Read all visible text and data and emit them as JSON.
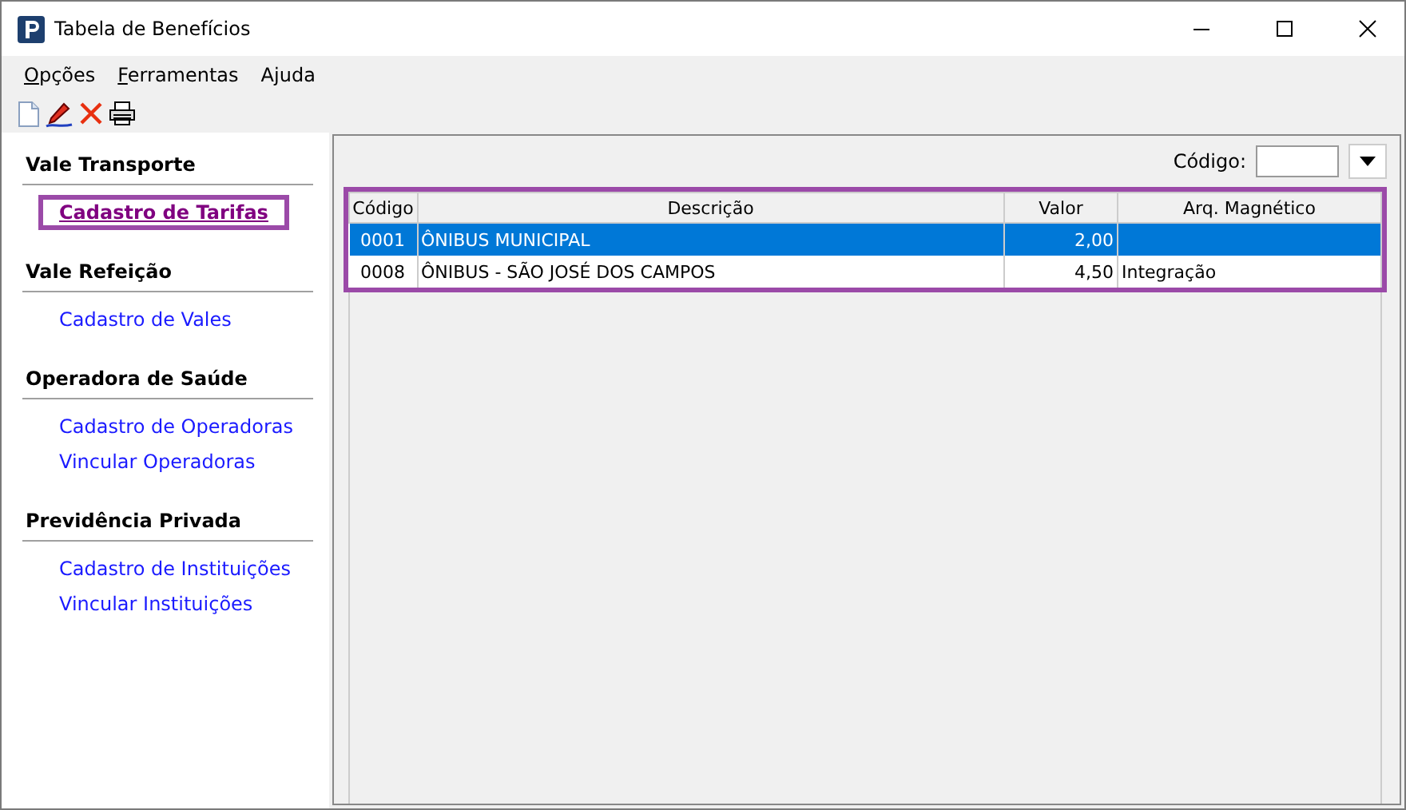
{
  "window": {
    "title": "Tabela de Benefícios"
  },
  "menu": [
    {
      "access_key": "O",
      "rest": "pções"
    },
    {
      "access_key": "F",
      "rest": "erramentas"
    },
    {
      "rest": "Ajuda"
    }
  ],
  "sidebar": {
    "groups": [
      {
        "title": "Vale Transporte",
        "items": [
          {
            "label": "Cadastro de Tarifas",
            "selected": true,
            "highlighted": true
          }
        ]
      },
      {
        "title": "Vale Refeição",
        "items": [
          {
            "label": "Cadastro de Vales",
            "selected": false,
            "highlighted": false
          }
        ]
      },
      {
        "title": "Operadora de Saúde",
        "items": [
          {
            "label": "Cadastro de Operadoras",
            "selected": false,
            "highlighted": false
          },
          {
            "label": "Vincular Operadoras",
            "selected": false,
            "highlighted": false
          }
        ]
      },
      {
        "title": "Previdência Privada",
        "items": [
          {
            "label": "Cadastro de Instituições",
            "selected": false,
            "highlighted": false
          },
          {
            "label": "Vincular Instituições",
            "selected": false,
            "highlighted": false
          }
        ]
      }
    ]
  },
  "filter": {
    "label": "Código:"
  },
  "table": {
    "highlighted": true,
    "columns": [
      "Código",
      "Descrição",
      "Valor",
      "Arq. Magnético"
    ],
    "rows": [
      {
        "cells": [
          "0001",
          "ÔNIBUS MUNICIPAL",
          "2,00",
          ""
        ],
        "selected": true
      },
      {
        "cells": [
          "0008",
          "ÔNIBUS - SÃO JOSÉ DOS CAMPOS",
          "4,50",
          "Integração"
        ],
        "selected": false
      }
    ]
  }
}
